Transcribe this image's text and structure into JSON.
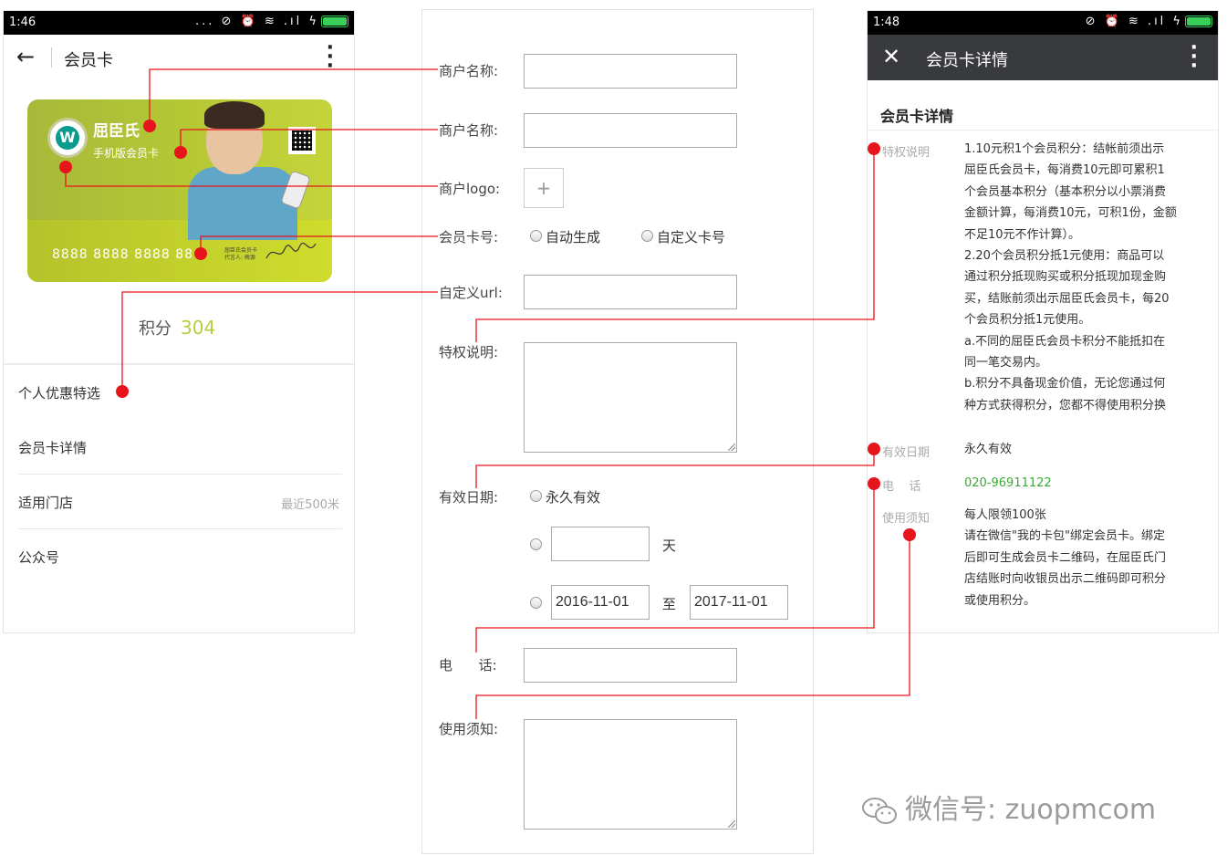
{
  "left_phone": {
    "status_time": "1:46",
    "status_icons": "... ⊘ ⏰ ≋ .ıl ϟ",
    "back_icon": "arrow-left-icon",
    "title": "会员卡",
    "more_icon": "more-vertical-icon",
    "card": {
      "logo_letter": "W",
      "merchant_name": "屈臣氏",
      "subtitle": "手机版会员卡",
      "number": "8888 8888 8888 88",
      "fine_print_1": "屈臣氏会员卡",
      "fine_print_2": "代言人: 梅源",
      "bg_color": "#b4c734"
    },
    "points_label": "积分",
    "points_value": "304",
    "points_color": "#b2cf3d",
    "menu": [
      {
        "label": "个人优惠特选"
      },
      {
        "label": "会员卡详情"
      },
      {
        "label": "适用门店",
        "note": "最近500米"
      },
      {
        "label": "公众号"
      }
    ]
  },
  "form": {
    "merchant_name_label_1": "商户名称:",
    "merchant_name_label_2": "商户名称:",
    "logo_label": "商户logo:",
    "logo_add": "+",
    "card_no_label": "会员卡号:",
    "card_no_option_auto": "自动生成",
    "card_no_option_custom": "自定义卡号",
    "url_label": "自定义url:",
    "privilege_label": "特权说明:",
    "validity_label": "有效日期:",
    "validity_forever": "永久有效",
    "validity_days_unit": "天",
    "date_from": "2016-11-01",
    "date_to_sep": "至",
    "date_to": "2017-11-01",
    "phone_label": "电      话:",
    "notice_label": "使用须知:"
  },
  "right_phone": {
    "status_time": "1:48",
    "status_icons": "⊘ ⏰ ≋ .ıl ϟ",
    "close_icon": "close-icon",
    "title": "会员卡详情",
    "more_icon": "more-vertical-icon",
    "header_color": "#393a3e",
    "section_title": "会员卡详情",
    "privilege_key": "特权说明",
    "privilege_lines": [
      "1.10元积1个会员积分：结帐前须出示",
      "屈臣氏会员卡，每消费10元即可累积1",
      "个会员基本积分（基本积分以小票消费",
      "金额计算，每消费10元，可积1份，金额",
      "不足10元不作计算）。",
      "2.20个会员积分抵1元使用：商品可以",
      "通过积分抵现购买或积分抵现加现金购",
      "买，结账前须出示屈臣氏会员卡，每20",
      "个会员积分抵1元使用。",
      "a.不同的屈臣氏会员卡积分不能抵扣在",
      "同一笔交易内。",
      "b.积分不具备现金价值，无论您通过何",
      "种方式获得积分，您都不得使用积分换"
    ],
    "validity_key": "有效日期",
    "validity_val": "永久有效",
    "phone_key": "电    话",
    "phone_val": "020-96911122",
    "phone_color": "#3aa935",
    "notice_key": "使用须知",
    "notice_lines": [
      "每人限领100张",
      "请在微信\"我的卡包\"绑定会员卡。绑定",
      "后即可生成会员卡二维码，在屈臣氏门",
      "店结账时向收银员出示二维码即可积分",
      "或使用积分。"
    ]
  },
  "connector_color": "#e8141b",
  "watermark": "微信号: zuopmcom"
}
